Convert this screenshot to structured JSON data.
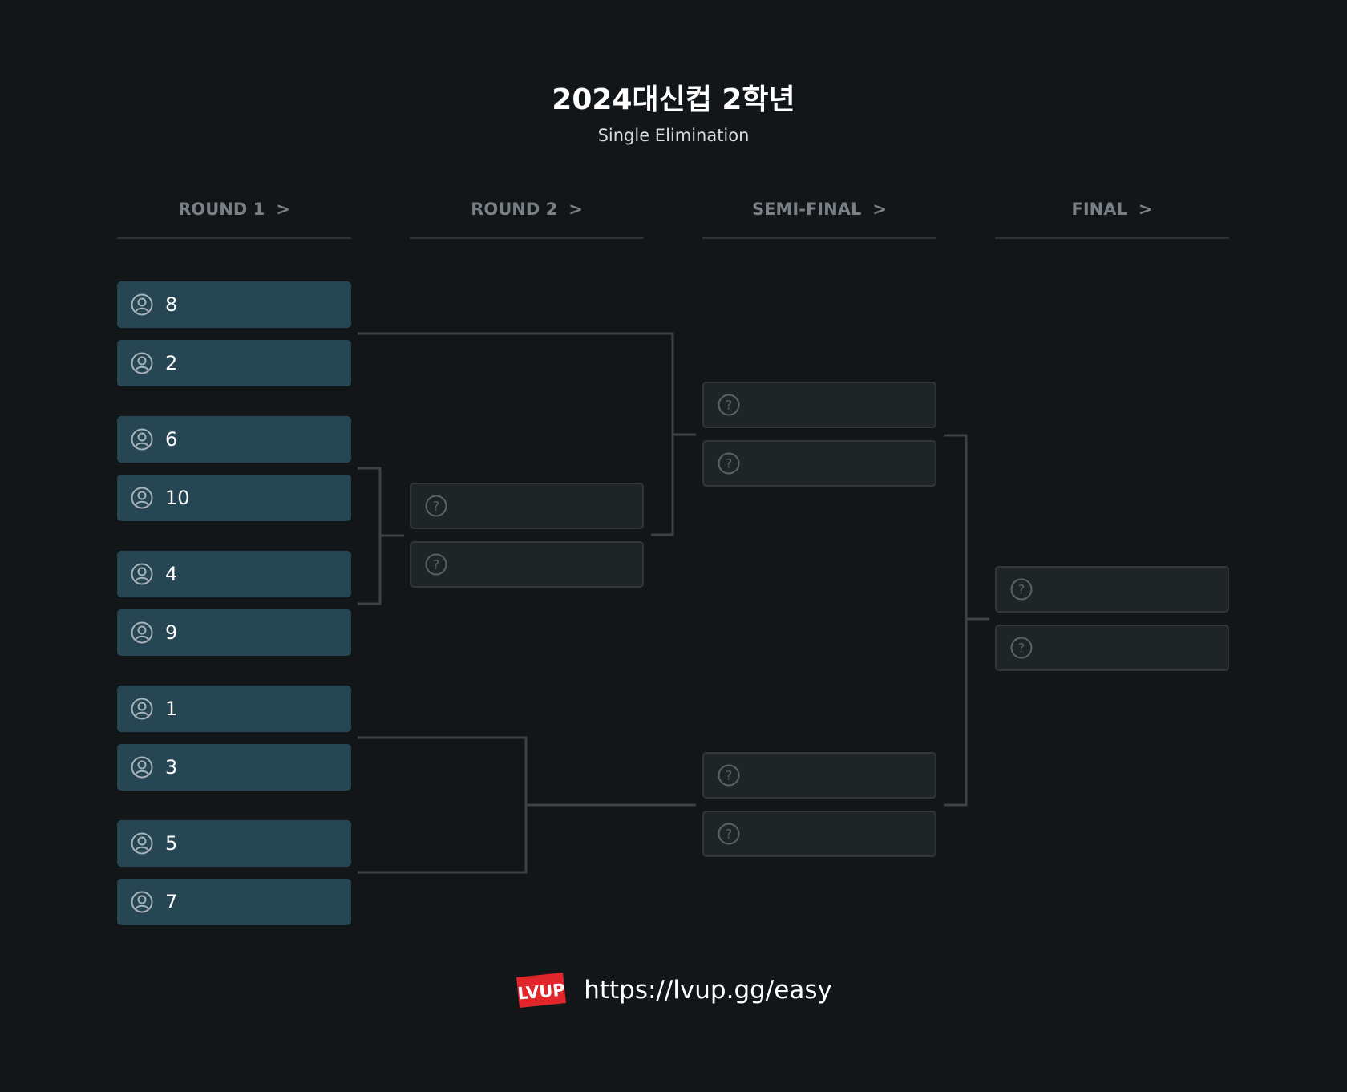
{
  "title": "2024대신컵 2학년",
  "subtitle": "Single Elimination",
  "rounds": [
    {
      "label": "ROUND 1",
      "chevron": ">"
    },
    {
      "label": "ROUND 2",
      "chevron": ">"
    },
    {
      "label": "SEMI-FINAL",
      "chevron": ">"
    },
    {
      "label": "FINAL",
      "chevron": ">"
    }
  ],
  "round1": [
    "8",
    "2",
    "6",
    "10",
    "4",
    "9",
    "1",
    "3",
    "5",
    "7"
  ],
  "footer": {
    "logo_text": "LVUP",
    "url": "https://lvup.gg/easy"
  },
  "colors": {
    "background": "#121619",
    "team_slot": "#264653",
    "tbd_slot": "#1f2427",
    "connector": "#3c4247",
    "logo": "#e0262b"
  },
  "icons": {
    "team": "user-circle-icon",
    "tbd": "question-circle-icon"
  }
}
